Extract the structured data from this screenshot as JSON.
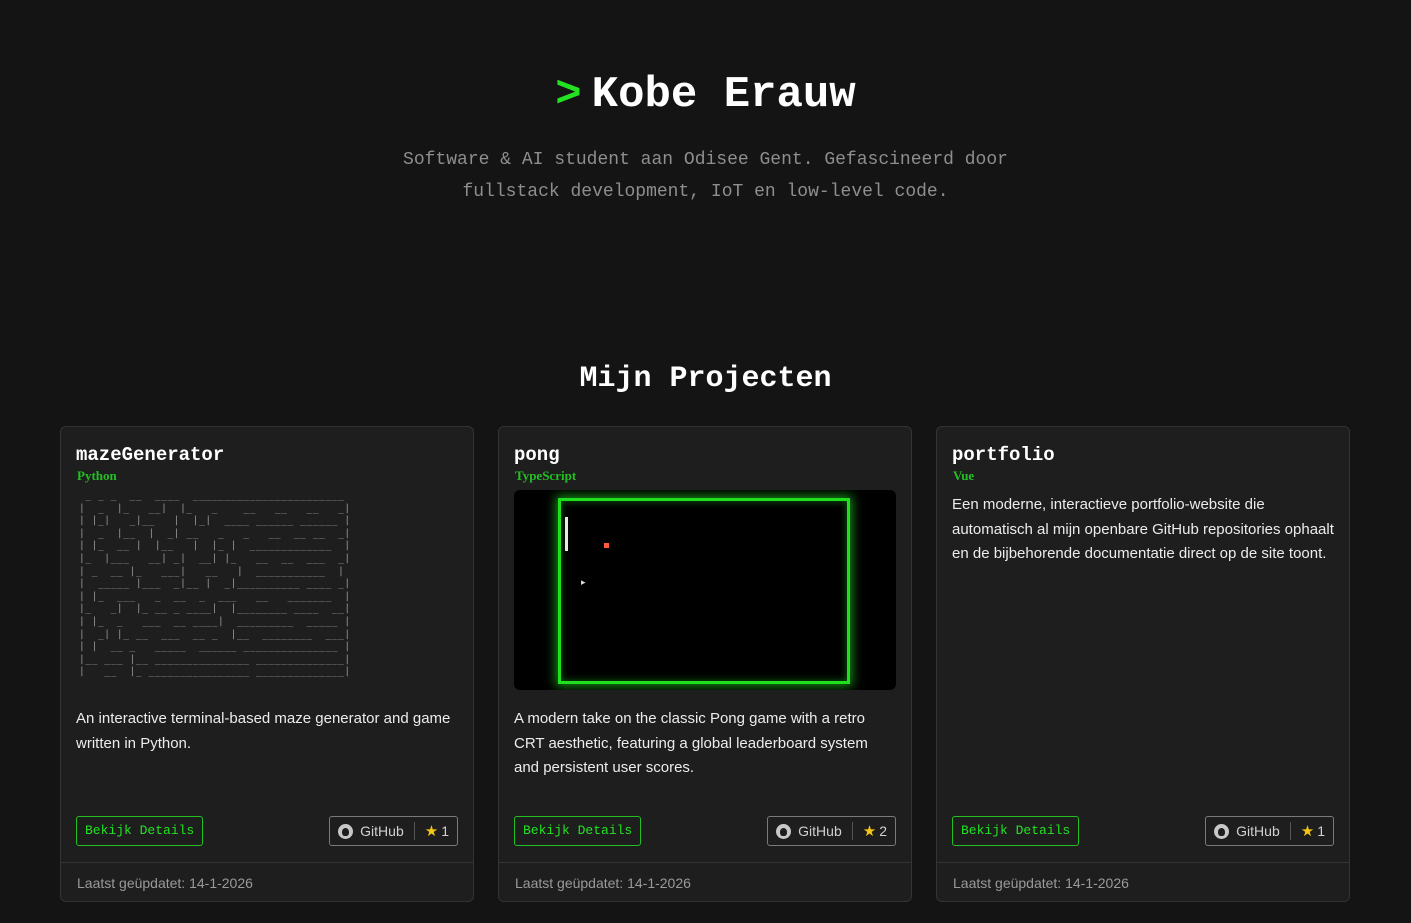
{
  "hero": {
    "prompt": ">",
    "name": "Kobe Erauw",
    "subtitle": "Software & AI student aan Odisee Gent. Gefascineerd door fullstack development, IoT en low-level code."
  },
  "projects_section": {
    "title": "Mijn Projecten",
    "cards": [
      {
        "title": "mazeGenerator",
        "language": "Python",
        "preview": "ascii-maze",
        "maze_rows": [
          " _ _ _  __  ____  ________________________",
          "|  _  |_   __|  |_   _    __   __   __   _|",
          "| |_|   _|__   |  |_|  ____ ______ ______ |",
          "|  _  |__  |  _| __   _   _   __  __ __  _|",
          "| |_  __ |  |__   |  |_ |  _____________  |",
          "|_  |___   __| _|  __| |_   __  __  ___  _|",
          "| _  __ |_   ___|   __   |  ___________  |",
          "|  _____ |___  _|__ |  _|__________ ____ _|",
          "| |_  ___   _  __  _  ___   __   _______  |",
          "|_   _|  |_ __ _ ____|  |________ ____  __|",
          "| |_  _   ___  __ ____|  _________  _____ |",
          "|  _| |_ __  ___  __ _  |__  ________  ___|",
          "| |  __ _   _____  ______ _______________ |",
          "|__ ___ |__ _______________ ______________|",
          "|   __  |_ ________________ ______________|"
        ],
        "description": "An interactive terminal-based maze generator and game written in Python.",
        "details_label": "Bekijk Details",
        "github_label": "GitHub",
        "stars": "1",
        "updated": "Laatst geüpdatet: 14-1-2026"
      },
      {
        "title": "pong",
        "language": "TypeScript",
        "preview": "pong-screenshot",
        "description": "A modern take on the classic Pong game with a retro CRT aesthetic, featuring a global leaderboard system and persistent user scores.",
        "details_label": "Bekijk Details",
        "github_label": "GitHub",
        "stars": "2",
        "updated": "Laatst geüpdatet: 14-1-2026"
      },
      {
        "title": "portfolio",
        "language": "Vue",
        "preview": "none",
        "description": "Een moderne, interactieve portfolio-website die automatisch al mijn openbare GitHub repositories ophaalt en de bijbehorende documentatie direct op de site toont.",
        "details_label": "Bekijk Details",
        "github_label": "GitHub",
        "stars": "1",
        "updated": "Laatst geüpdatet: 14-1-2026"
      }
    ]
  },
  "colors": {
    "background": "#141414",
    "card": "#1e1e1e",
    "accent": "#22e222",
    "star": "#f5c518"
  },
  "icons": {
    "github": "github-icon",
    "star": "star-icon"
  }
}
